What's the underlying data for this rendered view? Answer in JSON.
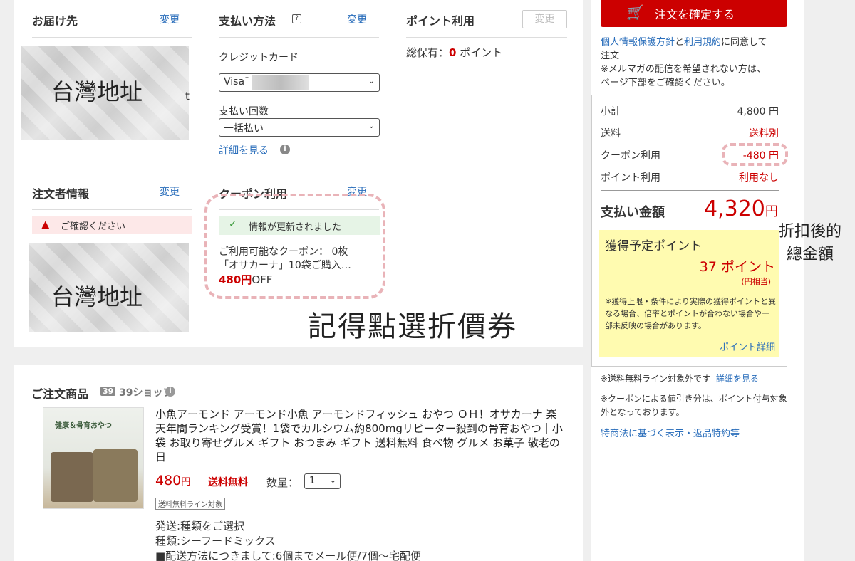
{
  "shipping": {
    "title": "お届け先",
    "change": "変更",
    "masked_text": "台灣地址",
    "masked_tail": "t"
  },
  "payment": {
    "title": "支払い方法",
    "help_icon": "?",
    "change": "変更",
    "method_label": "クレジットカード",
    "card_value": "Visa¯",
    "installments_label": "支払い回数",
    "installments_value": "一括払い",
    "details_link": "詳細を見る",
    "info_icon": "i"
  },
  "points": {
    "title": "ポイント利用",
    "change": "変更",
    "total_prefix": "総保有：",
    "total_value": "0",
    "total_suffix": " ポイント"
  },
  "orderer": {
    "title": "注文者情報",
    "change": "変更",
    "alert": "ご確認ください",
    "masked_text": "台灣地址"
  },
  "coupon": {
    "title": "クーポン利用",
    "change": "変更",
    "updated": "情報が更新されました",
    "available": "ご利用可能なクーポン： 0枚",
    "desc": "「オサカーナ」10袋ご購入…",
    "discount_amount": "480円",
    "discount_suffix": "OFF"
  },
  "annotation_coupon": "記得點選折價券",
  "annotation_total": [
    "折扣後的",
    "總金額"
  ],
  "products": {
    "title": "ご注文商品",
    "shop_name": "39ショップ",
    "shop_logo": "39",
    "image_caption": "健康＆骨育おやつ",
    "name": "小魚アーモンド アーモンド小魚 アーモンドフィッシュ おやつ ＯＨ！オサカーナ 楽天年間ランキング受賞！1袋でカルシウム約800mgリピーター殺到の骨育おやつ｜小袋 お取り寄せグルメ ギフト おつまみ ギフト 送料無料 食べ物 グルメ お菓子 敬老の日",
    "price": "480",
    "price_unit": "円",
    "free_shipping": "送料無料",
    "qty_label": "数量：",
    "qty_value": "1",
    "tag": "送料無料ライン対象",
    "option1": "発送:種類をご選択",
    "option2": "種類:シーフードミックス",
    "option3": "■配送方法につきまして:6個までメール便/7個〜宅配便"
  },
  "sidebar": {
    "confirm_button": "注文を確定する",
    "agree_link1": "個人情報保護方針",
    "agree_mid": "と",
    "agree_link2": "利用規約",
    "agree_suffix": "に同意して",
    "agree_line2": "注文",
    "mailmag_line1": "※メルマガの配信を希望されない方は、",
    "mailmag_line2": "ページ下部をご確認ください。",
    "summary": [
      {
        "label": "小計",
        "value": "4,800 円",
        "color": "#333333"
      },
      {
        "label": "送料",
        "value": "送料別",
        "color": "#cc0000"
      },
      {
        "label": "クーポン利用",
        "value": "-480 円",
        "color": "#cc0000"
      },
      {
        "label": "ポイント利用",
        "value": "利用なし",
        "color": "#cc0000"
      }
    ],
    "total_label": "支払い金額",
    "total_value": "4,320",
    "total_unit": "円",
    "earn_title": "獲得予定ポイント",
    "earn_points": "37 ポイント",
    "earn_yen": "(円相当)",
    "earn_note": "※獲得上限・条件により実際の獲得ポイントと異なる場合、倍率とポイントが合わない場合や一部未反映の場合があります。",
    "earn_link": "ポイント詳細",
    "note1_text": "※送料無料ライン対象外です",
    "note1_link": "詳細を見る",
    "note2": "※クーポンによる値引き分は、ポイント付与対象外となっております。",
    "law_link": "特商法に基づく表示・返品特約等"
  },
  "colors": {
    "accent_red": "#cc0000",
    "link_blue": "#2a6ebb",
    "points_yellow": "#fffbb0",
    "success_green": "#e6f4e6"
  }
}
